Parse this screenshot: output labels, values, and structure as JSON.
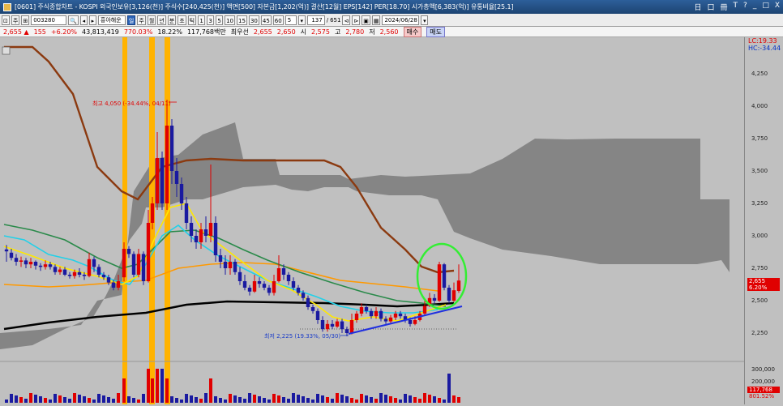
{
  "window": {
    "title": "[0601] 주식종합차트 - KOSPI 외국인보유[3,126(천)] 주식수[240,425(천)] 액면[500] 자본금[1,202(억)] 결산[12월] EPS[142] PER[18.70] 시가총액[6,383(억)] 유통비율[25.1]",
    "controls": [
      "日",
      "口",
      "冊",
      "T",
      "?",
      "_",
      "□",
      "X"
    ]
  },
  "toolbar": {
    "left_buttons": [
      "⊡",
      "주",
      "⊞"
    ],
    "code": "003280",
    "stock_name": "흥아해운",
    "period_buttons": [
      "주",
      "월",
      "년",
      "분",
      "초",
      "틱"
    ],
    "interval_buttons": [
      "1",
      "3",
      "5",
      "10",
      "15",
      "30",
      "45",
      "60",
      "5"
    ],
    "count": "137",
    "total": "651",
    "date": "2024/06/28"
  },
  "infobar": {
    "price": "2,655",
    "change_arrow": "▲",
    "change": "155",
    "change_pct": "+6.20%",
    "volume": "43,813,419",
    "volume_pct": "770.03%",
    "turnover": "18.22%",
    "amount": "117,768백만",
    "ma_label": "최우선",
    "ask": "2,655",
    "bid": "2,650",
    "open_label": "시",
    "open": "2,575",
    "high_label": "고",
    "high": "2,780",
    "low_label": "저",
    "low": "2,560",
    "buy_label": "매수",
    "sell_label": "매도"
  },
  "chart_data": {
    "type": "candlestick",
    "y_ticks": [
      "4,250",
      "4,000",
      "3,750",
      "3,500",
      "3,250",
      "3,000",
      "2,750",
      "2,500",
      "2,250"
    ],
    "ylim": [
      2150,
      4450
    ],
    "annotations": [
      {
        "text": "최고 4,050 (-34.44%, 04/11)",
        "color": "#e00000"
      },
      {
        "text": "최저 2,225 (19.33%, 05/30)",
        "color": "#1a3cc8"
      }
    ],
    "lc_label": "LC:19.33",
    "hc_label": "HC:-34.44",
    "current_price_badge": "2,655",
    "current_pct_badge": "6.20%",
    "volume_ticks": [
      "300,000",
      "200,000"
    ],
    "volume_badge": "117,768",
    "volume_pct_badge": "801.52%",
    "colors": {
      "up": "#e00000",
      "down": "#1a1aa0",
      "highlight": "#ffb300",
      "circle": "#33ee33",
      "trend": "#1f2fe0",
      "ma_long": "#000000",
      "ma_mid": "#ff9900",
      "ma_green": "#2a8a4a",
      "ma_cyan": "#22d0e8",
      "ma_yellow": "#ffe800",
      "ichimoku_line": "#8b3a10",
      "cloud": "#7a7a7a"
    }
  }
}
